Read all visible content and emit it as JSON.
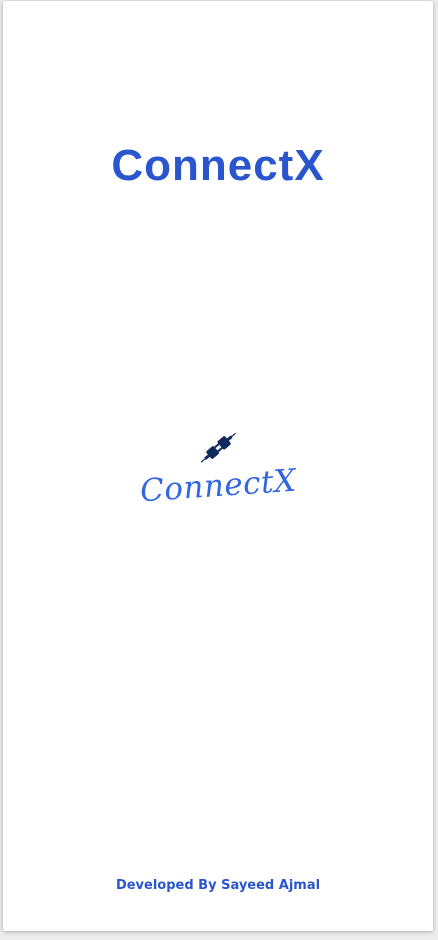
{
  "app": {
    "title": "ConnectX"
  },
  "logo": {
    "icon": "plug-icon",
    "text": "ConnectX",
    "color": "#3266e0",
    "icon_color": "#0f2a5c"
  },
  "footer": {
    "credit": "Developed By Sayeed Ajmal"
  },
  "colors": {
    "brand": "#2a55cc",
    "background": "#ffffff"
  }
}
